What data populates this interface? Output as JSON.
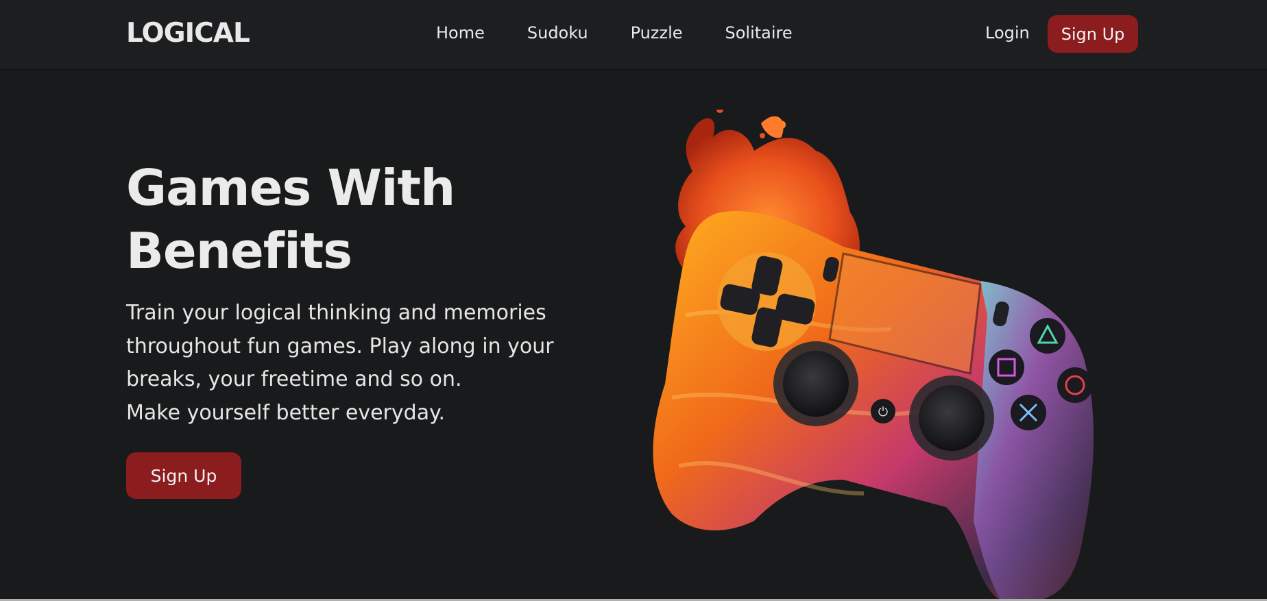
{
  "navbar": {
    "logo": "LOGICAL",
    "links": [
      {
        "label": "Home"
      },
      {
        "label": "Sudoku"
      },
      {
        "label": "Puzzle"
      },
      {
        "label": "Solitaire"
      }
    ],
    "login_label": "Login",
    "signup_label": "Sign Up"
  },
  "hero": {
    "title_lines": [
      "Games With",
      "Benefits"
    ],
    "description_lines": [
      "Train your logical thinking and memories",
      "throughout fun games. Play along in your",
      "breaks, your freetime and so on.",
      "Make yourself better everyday."
    ],
    "signup_label": "Sign Up",
    "image_subject": "gamepad-controller-with-fire-splash"
  },
  "colors": {
    "background": "#191a1b",
    "navbar": "#1d1e20",
    "accent": "#8b1d1f",
    "text": "#ebebeb"
  }
}
